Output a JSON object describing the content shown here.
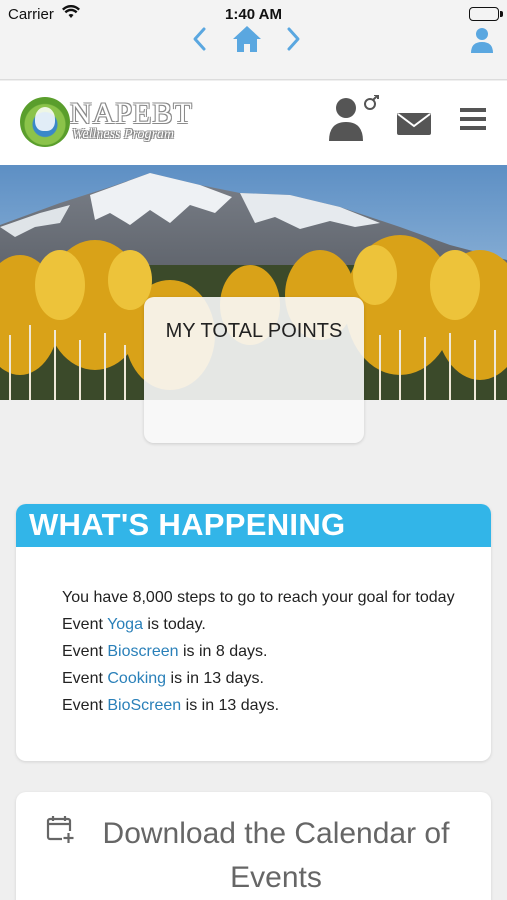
{
  "status_bar": {
    "carrier": "Carrier",
    "time": "1:40 AM"
  },
  "browser_nav": {
    "back_icon": "chevron-left-icon",
    "home_icon": "home-icon",
    "forward_icon": "chevron-right-icon",
    "profile_icon": "user-icon",
    "accent": "#5aa7e0"
  },
  "brand": {
    "name": "NAPEBT",
    "tagline": "Wellness Program"
  },
  "header_icons": [
    "user-gender-icon",
    "mail-icon",
    "hamburger-menu-icon"
  ],
  "points_card": {
    "title": "MY TOTAL POINTS"
  },
  "whats_happening": {
    "title": "WHAT'S HAPPENING",
    "accent": "#32b5e8",
    "steps_message": "You have 8,000 steps to go to reach your goal for today",
    "events": [
      {
        "prefix": "Event ",
        "name": "Yoga",
        "suffix": " is today."
      },
      {
        "prefix": "Event ",
        "name": "Bioscreen",
        "suffix": " is in 8 days."
      },
      {
        "prefix": "Event ",
        "name": "Cooking",
        "suffix": " is in 13 days."
      },
      {
        "prefix": "Event ",
        "name": "BioScreen",
        "suffix": " is in 13 days."
      }
    ]
  },
  "calendar_card": {
    "icon": "calendar-add-icon",
    "label": "Download the Calendar of Events"
  }
}
